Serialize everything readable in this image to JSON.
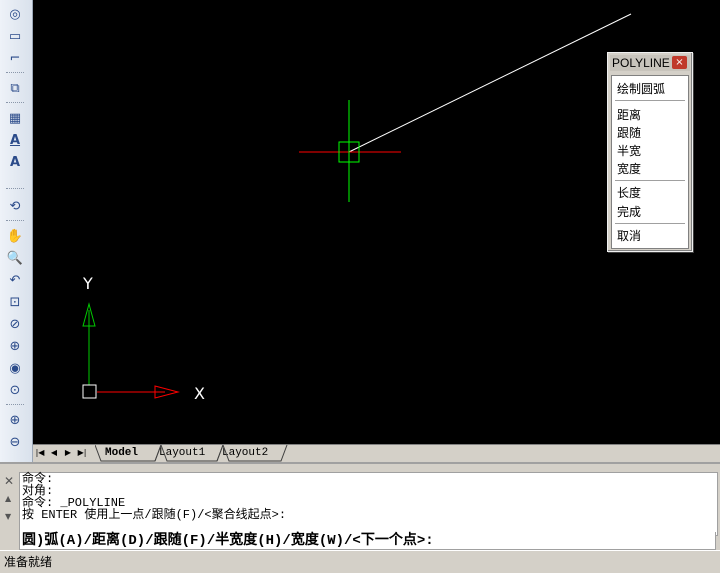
{
  "toolbar": {
    "icons": [
      "circle-icon",
      "rect-tool-icon",
      "fillet-icon",
      "region-icon",
      "hatch-icon",
      "text-icon",
      "mtext-icon",
      "regen-icon",
      "pan-icon",
      "zoom-realtime-icon",
      "zoom-previous-icon",
      "zoom-window-icon",
      "zoom-dynamic-icon",
      "zoom-scale-icon",
      "zoom-center-icon",
      "zoom-object-icon",
      "zoom-in-icon",
      "zoom-out-icon"
    ]
  },
  "canvas": {
    "ucs_y_label": "Y",
    "ucs_x_label": "X",
    "crosshair_color": "#ff0000",
    "crosshair_v_color": "#00ff00",
    "line_color": "#ffffff"
  },
  "polyline_menu": {
    "title": "POLYLINE",
    "close": "×",
    "items": {
      "arc": "绘制圆弧",
      "distance": "距离",
      "follow": "跟随",
      "halfwidth": "半宽",
      "width": "宽度",
      "length": "长度",
      "done": "完成",
      "cancel": "取消"
    }
  },
  "tabs": {
    "model": "Model",
    "layout1": "Layout1",
    "layout2": "Layout2"
  },
  "command": {
    "lines": [
      "命令:",
      "对角:",
      "命令: _POLYLINE",
      "按 ENTER 使用上一点/跟随(F)/<聚合线起点>:"
    ],
    "prompt": "圆)弧(A)/距离(D)/跟随(F)/半宽度(H)/宽度(W)/<下一个点>:"
  },
  "status": {
    "text": "准备就绪"
  }
}
